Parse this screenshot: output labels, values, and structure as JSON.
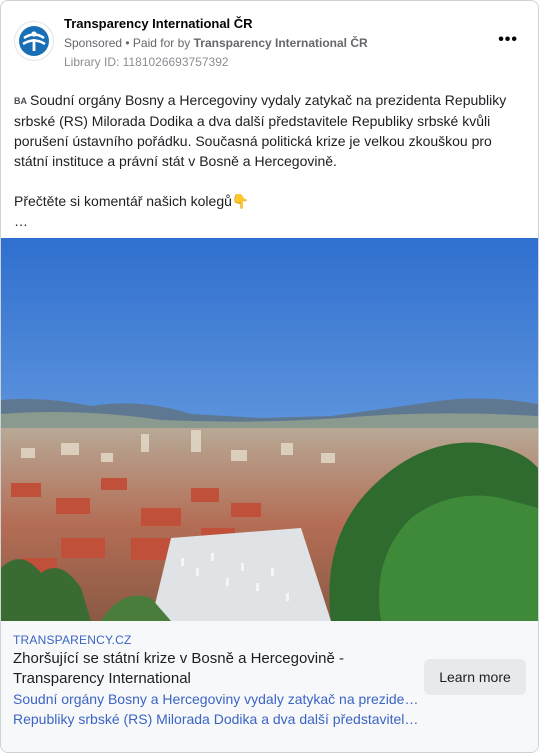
{
  "advertiser": {
    "name": "Transparency International ČR",
    "sponsored_label": "Sponsored",
    "separator": " • ",
    "paid_for_prefix": "Paid for by ",
    "paid_for_by": "Transparency International ČR",
    "library_id": "Library ID: 1181026693757392",
    "more_label": "•••"
  },
  "post": {
    "flag_label": "BA",
    "paragraph1": "Soudní orgány Bosny a Hercegoviny vydaly zatykač na prezidenta Republiky srbské (RS) Milorada Dodika a dva další představitele Republiky srbské kvůli porušení ústavního pořádku. Současná politická krize je velkou zkouškou pro státní instituce a právní stát v Bosně a Hercegovině.",
    "paragraph2": "Přečtěte si komentář našich kolegů👇",
    "truncation": "…"
  },
  "link": {
    "domain": "TRANSPARENCY.CZ",
    "headline": "Zhoršující se státní krize v Bosně a Hercegovině - Transparency International",
    "description_line1": "Soudní orgány Bosny a Hercegoviny vydaly zatykač na prezidenta",
    "description_line2": "Republiky srbské (RS) Milorada Dodika a dva další představitele…",
    "cta_label": "Learn more"
  },
  "colors": {
    "link_blue": "#3b64c4",
    "brand_blue": "#1a6eb5",
    "sky": "#3f7fd6"
  }
}
